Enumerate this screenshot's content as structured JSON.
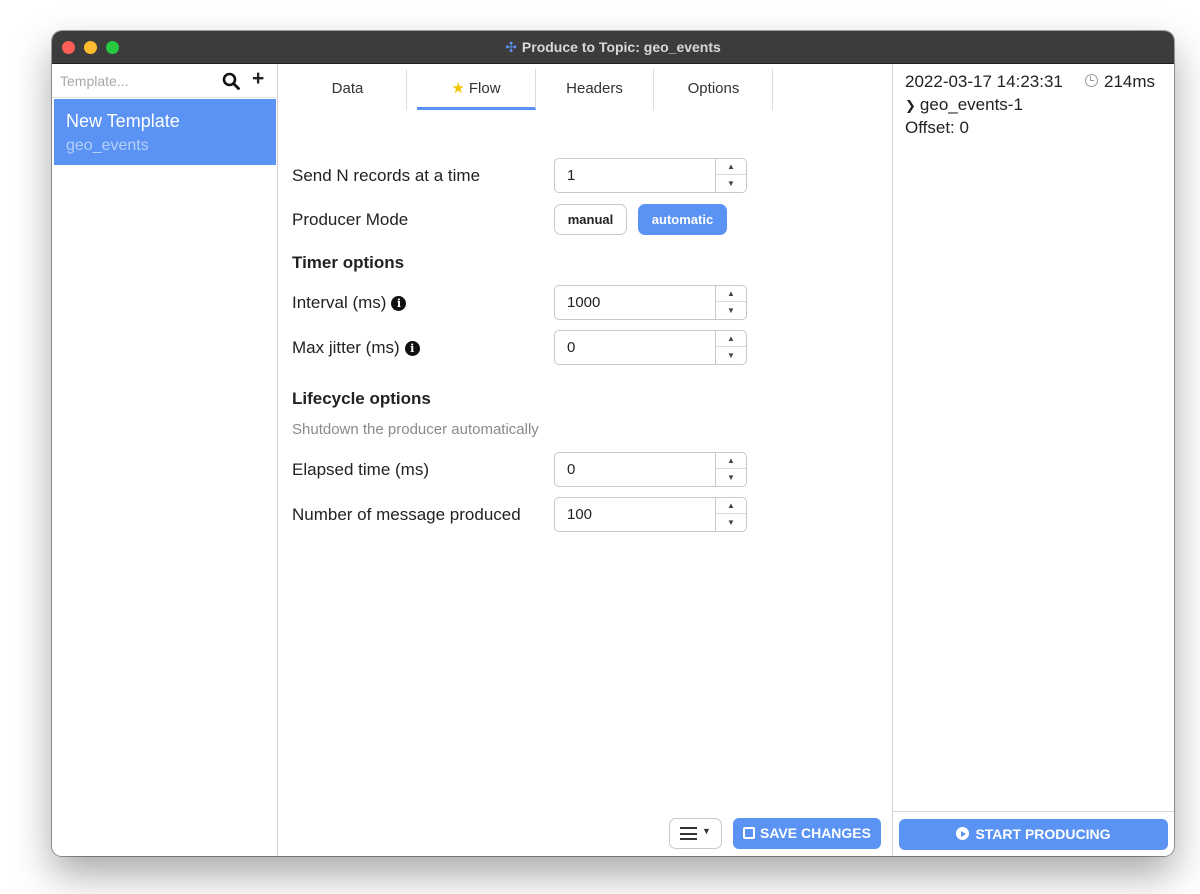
{
  "window": {
    "title": "Produce to Topic: geo_events",
    "title_icon": "kafka-icon"
  },
  "templates": {
    "search_placeholder": "Template...",
    "items": [
      {
        "name": "New Template",
        "topic": "geo_events"
      }
    ]
  },
  "tabs": [
    {
      "label": "Data"
    },
    {
      "label": "Flow",
      "icon": "star-icon",
      "active": true
    },
    {
      "label": "Headers"
    },
    {
      "label": "Options"
    }
  ],
  "flow": {
    "send_n_label": "Send N records at a time",
    "send_n_value": "1",
    "producer_mode_label": "Producer Mode",
    "mode_manual": "manual",
    "mode_automatic": "automatic",
    "selected_mode": "automatic",
    "timer_heading": "Timer options",
    "interval_label": "Interval (ms)",
    "interval_value": "1000",
    "jitter_label": "Max jitter (ms)",
    "jitter_value": "0",
    "lifecycle_heading": "Lifecycle options",
    "lifecycle_note": "Shutdown the producer automatically",
    "elapsed_label": "Elapsed time (ms)",
    "elapsed_value": "0",
    "num_messages_label": "Number of message produced",
    "num_messages_value": "100"
  },
  "footer": {
    "save_label": "SAVE CHANGES",
    "start_label": "START PRODUCING"
  },
  "log": {
    "timestamp": "2022-03-17 14:23:31",
    "duration": "214ms",
    "partition": "geo_events-1",
    "offset": "Offset: 0"
  },
  "colors": {
    "accent": "#5b93f5",
    "titlebar": "#3c3c3c",
    "star": "#f2c500"
  }
}
